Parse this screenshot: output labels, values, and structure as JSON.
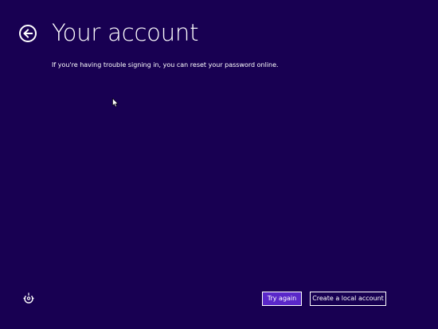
{
  "page": {
    "title": "Your account",
    "message": "If you're having trouble signing in, you can reset your password online."
  },
  "buttons": {
    "try_again_label": "Try again",
    "create_local_label": "Create a local account"
  },
  "icons": {
    "back": "back-arrow-icon",
    "ease_of_access": "ease-of-access-icon",
    "cursor": "mouse-cursor-icon"
  },
  "colors": {
    "background": "#180052",
    "primary_button": "#5a27c9",
    "text": "#ffffff"
  }
}
